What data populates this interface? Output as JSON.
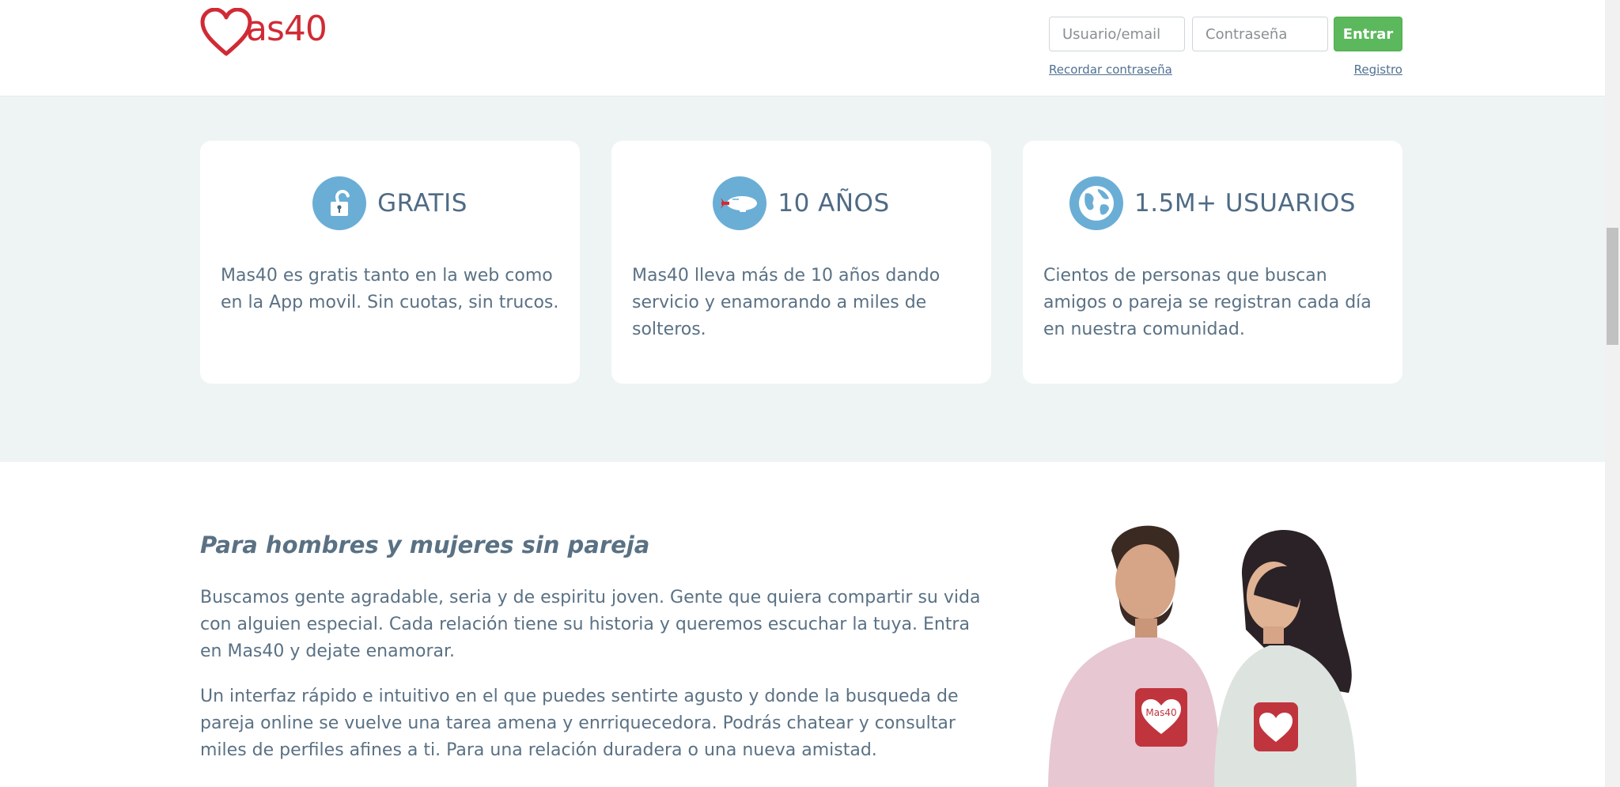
{
  "header": {
    "logo_text": "as40",
    "username_placeholder": "Usuario/email",
    "password_placeholder": "Contraseña",
    "login_button": "Entrar",
    "remember_link": "Recordar contraseña",
    "register_link": "Registro"
  },
  "features": [
    {
      "icon": "padlock-icon",
      "title": "GRATIS",
      "text": "Mas40 es gratis tanto en la web como en la App movil. Sin cuotas, sin trucos."
    },
    {
      "icon": "airship-icon",
      "title": "10 AÑOS",
      "text": "Mas40 lleva más de 10 años dando servicio y enamorando a miles de solteros."
    },
    {
      "icon": "globe-icon",
      "title": "1.5M+ USUARIOS",
      "text": "Cientos de personas que buscan amigos o pareja se registran cada día en nuestra comunidad."
    }
  ],
  "about": {
    "title": "Para hombres y mujeres sin pareja",
    "paragraph_1": "Buscamos gente agradable, seria y de espiritu joven. Gente que quiera compartir su vida con alguien especial. Cada relación tiene su historia y queremos escuchar la tuya. Entra en Mas40 y dejate enamorar.",
    "paragraph_2": "Un interfaz rápido e intuitivo en el que puedes sentirte agusto y donde la busqueda de pareja online se vuelve una tarea amena y enrriquecedora. Podrás chatear y consultar miles de perfiles afines a ti. Para una relación duradera o una nueva amistad.",
    "photo_shirt_label": "Mas40"
  },
  "colors": {
    "brand_red": "#d02b35",
    "accent_green": "#5cb85c",
    "band_bg": "#eef4f4",
    "icon_blue": "#6aaed6",
    "text": "#5a7184"
  }
}
